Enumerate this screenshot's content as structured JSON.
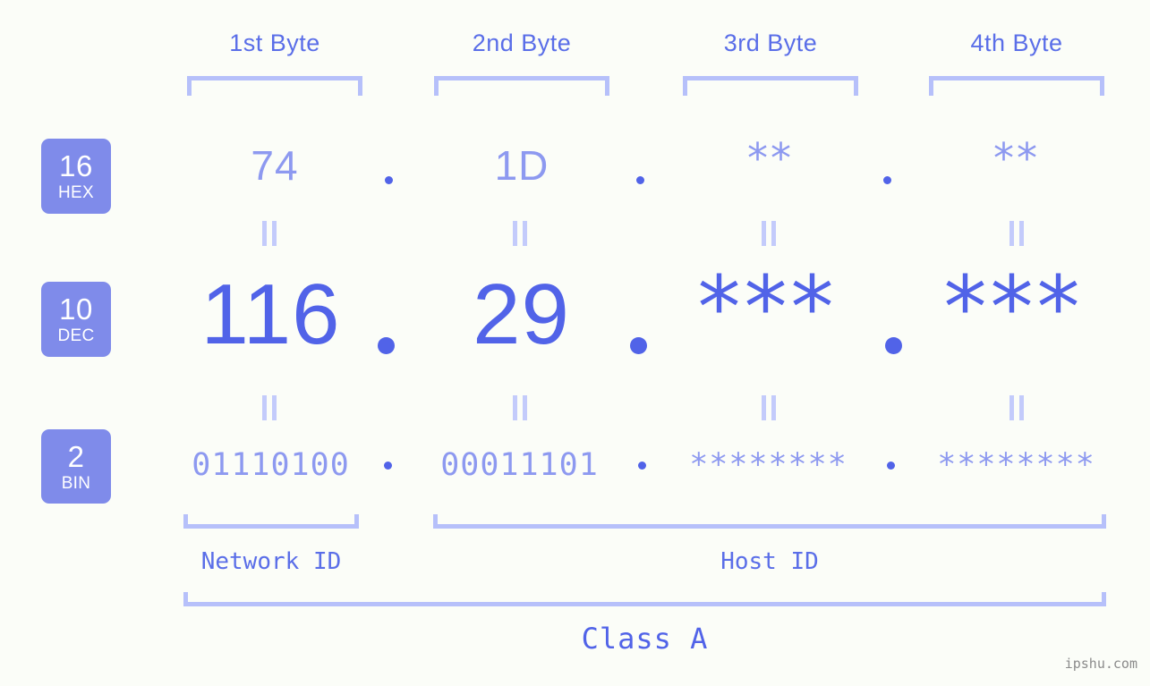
{
  "page": {
    "background": "#fbfdf8",
    "accent_strong": "#5163e8",
    "accent_light": "#8d99f0",
    "accent_bracket": "#b6c0fa",
    "badge_bg": "#7f8bea",
    "watermark": "ipshu.com"
  },
  "headers": [
    {
      "label": "1st Byte"
    },
    {
      "label": "2nd Byte"
    },
    {
      "label": "3rd Byte"
    },
    {
      "label": "4th Byte"
    }
  ],
  "rows": {
    "hex": {
      "badge_num": "16",
      "badge_name": "HEX",
      "values": [
        "74",
        "1D",
        "**",
        "**"
      ],
      "separators": [
        ".",
        ".",
        "."
      ]
    },
    "dec": {
      "badge_num": "10",
      "badge_name": "DEC",
      "values": [
        "116",
        "29",
        "***",
        "***"
      ],
      "separators": [
        ".",
        ".",
        "."
      ]
    },
    "bin": {
      "badge_num": "2",
      "badge_name": "BIN",
      "values": [
        "01110100",
        "00011101",
        "********",
        "********"
      ],
      "separators": [
        ".",
        ".",
        "."
      ]
    }
  },
  "equals_marks": {
    "symbol": "||",
    "count_per_row": 4
  },
  "footer": {
    "network_id_label": "Network ID",
    "host_id_label": "Host ID",
    "class_label": "Class A"
  }
}
